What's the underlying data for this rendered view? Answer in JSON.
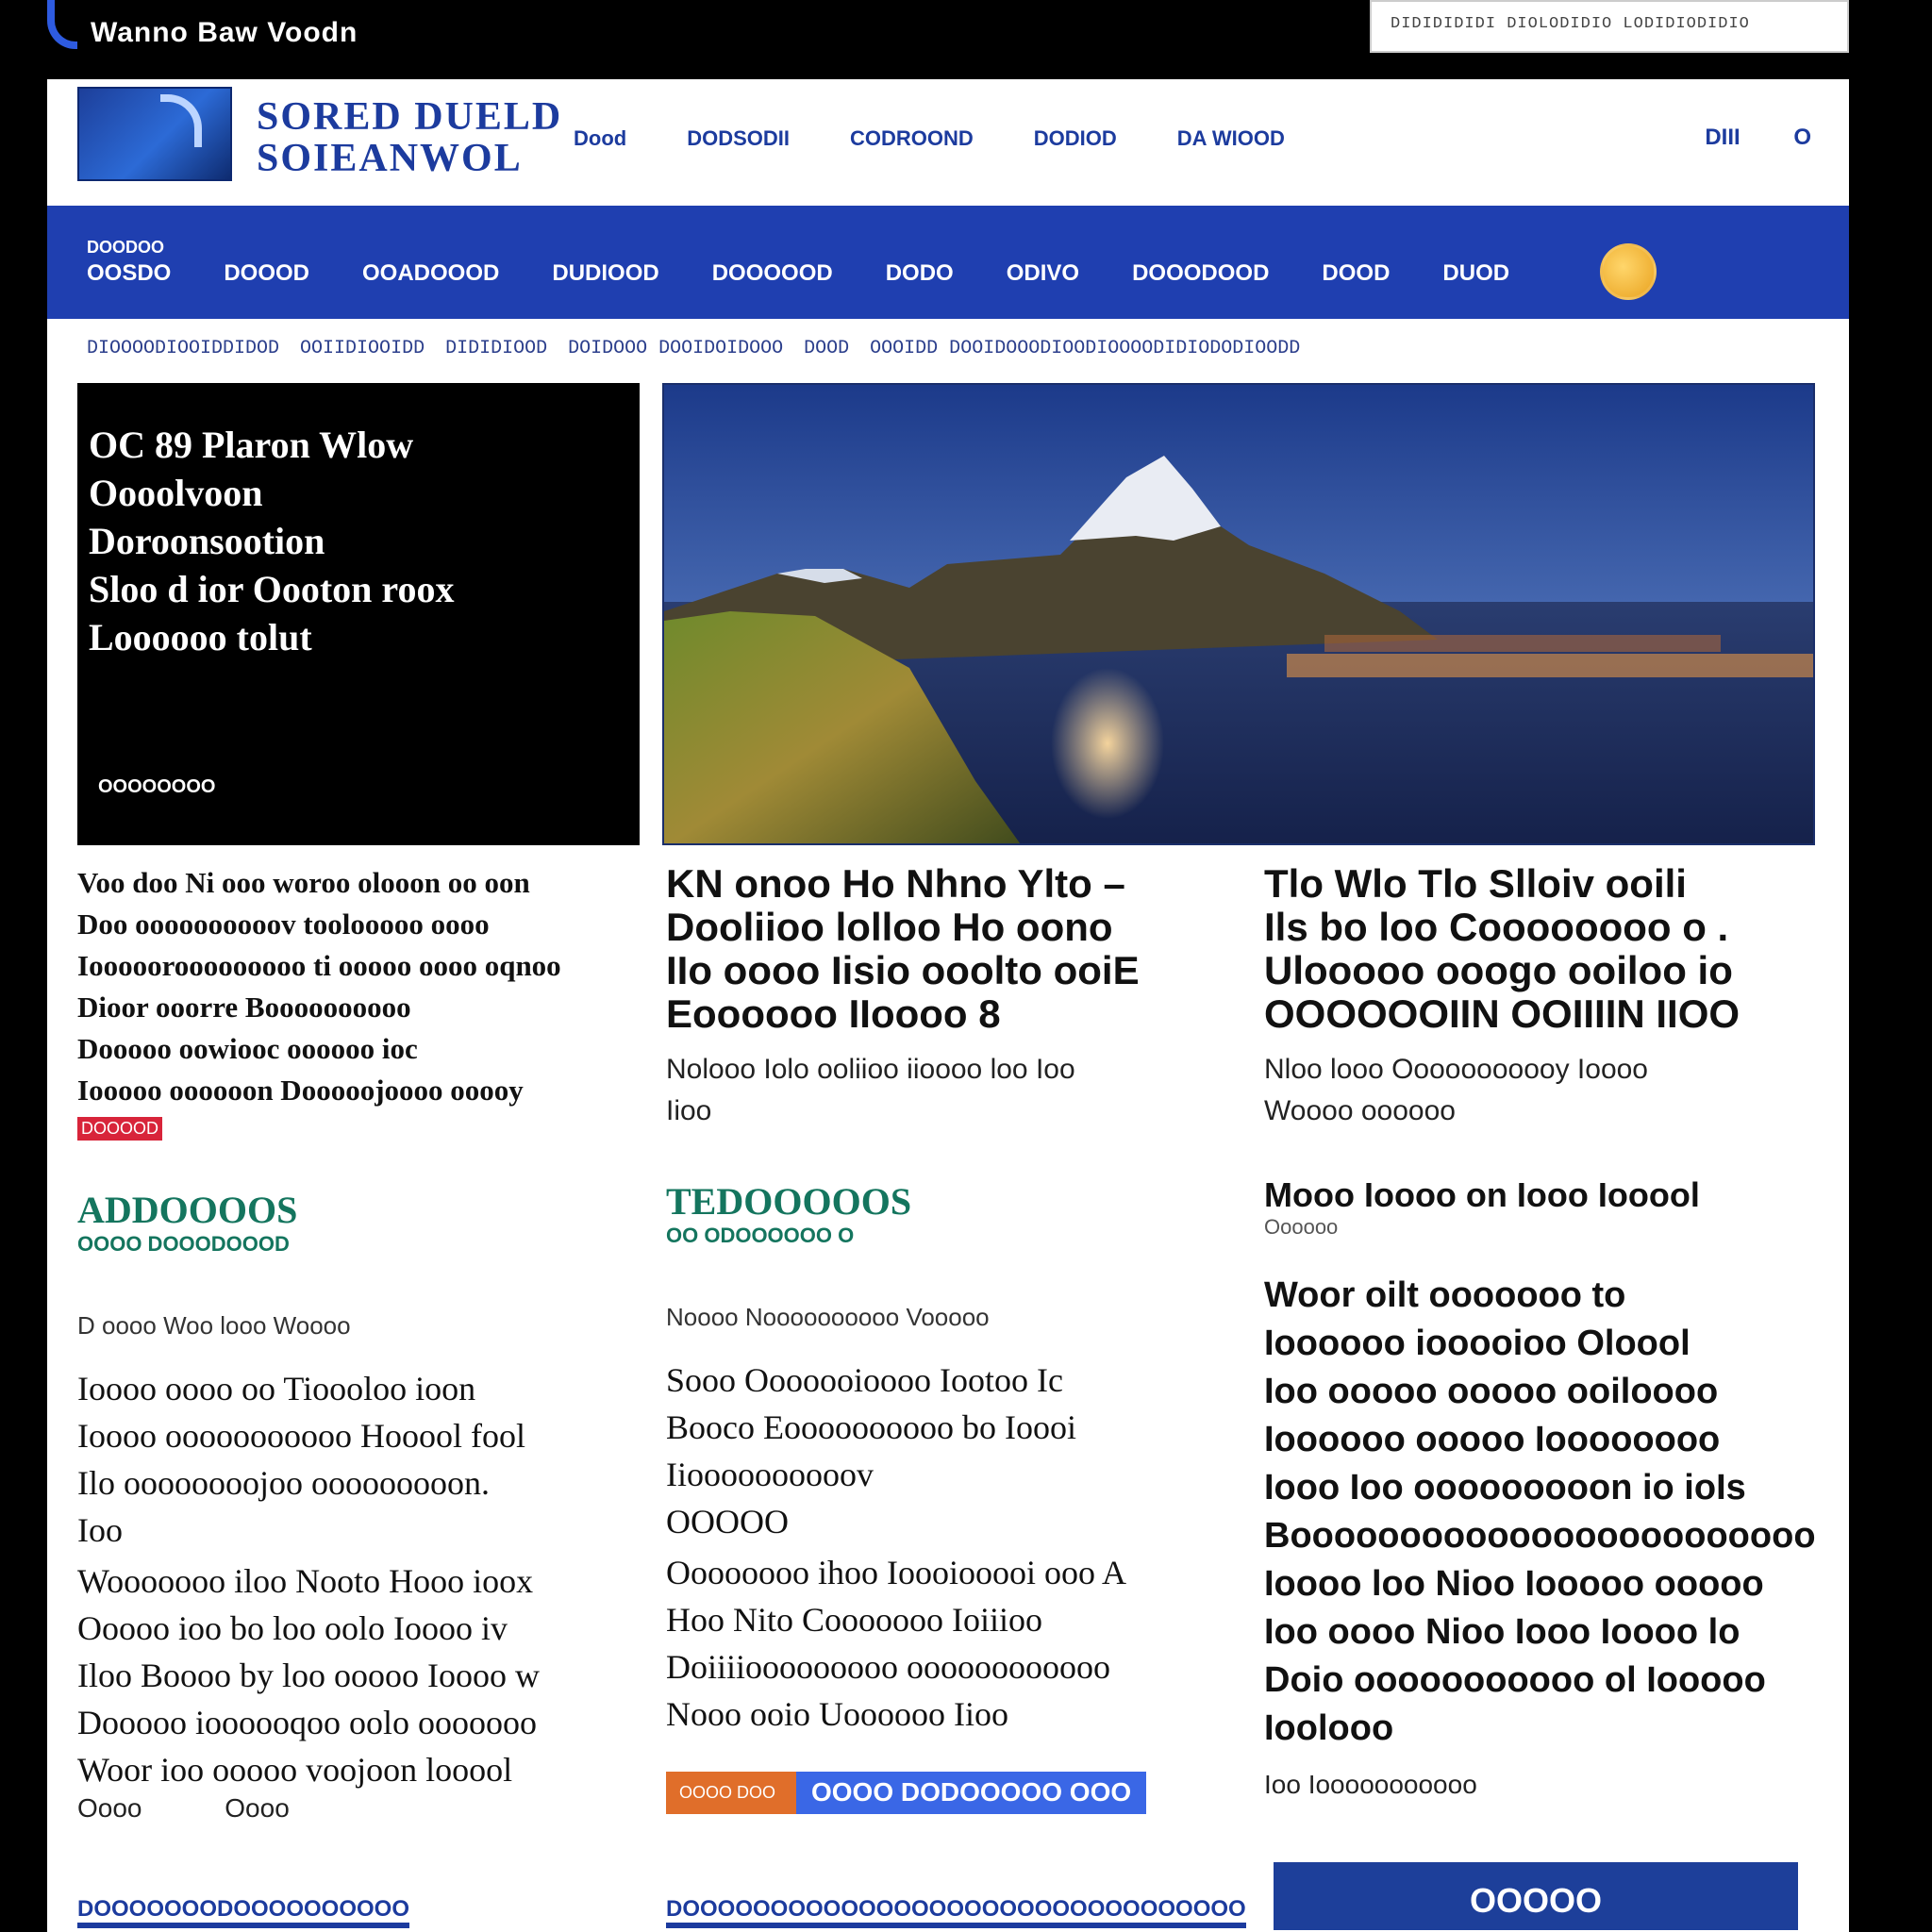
{
  "topbar": {
    "tagline": "Wanno Baw Voodn",
    "search_text": "DIDIDIDIDI DIOLODIDIO LODIDIODIDIO"
  },
  "header": {
    "logo_line1": "SORED DUELD",
    "logo_line2": "SOIEANWOL",
    "nav": [
      "Dood",
      "DODSODII",
      "CODROOND",
      "DODIOD",
      "DA WIOOD"
    ],
    "right": [
      "DIII",
      "O"
    ]
  },
  "mainnav": {
    "sub": "DOODOO",
    "items": [
      "OOSDO",
      "DOOOD",
      "OOADOOOD",
      "DUDIOOD",
      "DOOOOOD",
      "DODO",
      "ODIVO",
      "DOOODOOD",
      "DOOD",
      "DUOD"
    ]
  },
  "crumbs": [
    "DIOOOODIOOIDDIDOD",
    "OOIIDIOOIDD",
    "DIDIDIOOD",
    "DOIDOOO DOOIDOIDOOO",
    "DOOD",
    "OOOIDD DOOIDOOODIOODIOOOODIDIODODIOODD"
  ],
  "feature": {
    "text_lines": [
      "OC 89 Plaron Wlow",
      "Oooolvoon",
      "Doroonsootion",
      "Sloo d ior Oooton roox",
      "Loooooo tolut"
    ],
    "byline": "OOOOOOOO"
  },
  "col1": {
    "lead": [
      "Voo doo Ni ooo woroo olooon oo oon",
      "Doo oooooooooov toolooooo oooo",
      "Iooooorooooooooo ti ooooo oooo oqnoo",
      "Dioor ooorre Boooooooooo",
      "Dooooo oowiooc oooooo ioc",
      "Iooooo oooooon Dooooojoooo ooooy"
    ],
    "redtag": "DOOOOD",
    "section": "ADDOOOOS",
    "section_sub": "OOOO DOOODOOOD",
    "meta": "D oooo Woo looo Woooo",
    "para1": [
      "Ioooo oooo oo Tioooloo ioon",
      "Ioooo ooooooooooo Hooool fool",
      "Ilo oooooooojoo ooooooooon.",
      "Ioo"
    ],
    "para2": [
      "Wooooooo iloo Nooto Hooo ioox",
      "Ooooo ioo bo loo oolo Ioooo iv",
      "Iloo Boooo by loo ooooo Ioooo w",
      "Dooooo ioooooqoo oolo ooooooo",
      "Woor ioo ooooo voojoon looool"
    ],
    "small": [
      "Oooo",
      "Oooo"
    ],
    "footlink": "DOOOOOOODOOOOOOOOOO"
  },
  "col2": {
    "lead": [
      "KN onoo Ho Nhno Ylto –",
      "Dooliioo lolloo Ho oono",
      "IIo oooo Iisio ooolto ooiE",
      "Eoooooo IIoooo 8"
    ],
    "sub": [
      "Nolooo Iolo ooliioo iioooo loo Ioo",
      "Iioo"
    ],
    "section": "TEDOOOOOS",
    "section_sub": "OO ODOOOOOO O",
    "meta": "Noooo Noooooooooo Vooooo",
    "para1": [
      "Sooo Ooooooioooo Iootoo Ic",
      "Booco Eoooooooooo bo Ioooi",
      "Iioooooooooov",
      "OOOOO"
    ],
    "para2": [
      "Oooooooo ihoo Ioooiooooi ooo A",
      "Hoo Nito Cooooooo Ioiiioo",
      "Doiiiiooooooooo oooooooooooo",
      "Nooo ooio Uoooooo Iioo"
    ],
    "tag_orange": "OOOO DOO",
    "tag_blue": "OOOO DODOOOOO OOO",
    "footlink": "DOOOOOOOOOOOOOOOOOOOOOOOOOOOOOOOO"
  },
  "col3": {
    "lead": [
      "Tlo Wlo Tlo Slloiv ooili",
      "Ils bo loo Coooooooo o .",
      "Ulooooo ooogo ooiloo io",
      "OOOOOOIIN OOIIIIN IIOO"
    ],
    "sub": [
      "Nloo looo Ooooooooooy Ioooo",
      "Woooo oooooo"
    ],
    "h2": "Mooo Ioooo on Iooo Iooool",
    "h2sub": "Oooooo",
    "para": [
      "Woor oilt ooooooo to",
      "Ioooooo iooooioo Oloool",
      "Ioo ooooo ooooo ooiloooo",
      "Ioooooo ooooo Ioooooooo",
      "Iooo Ioo ooooooooon io ioIs",
      "Boooooooooooooooooooooooo",
      "Ioooo loo Nioo Iooooo ooooo",
      "Ioo oooo Nioo Iooo Ioooo lo",
      "Doio ooooooooooo ol Iooooo",
      "Ioolooo"
    ],
    "byline": "Ioo Iooooooooooo",
    "bluebox": "OOOOO"
  }
}
